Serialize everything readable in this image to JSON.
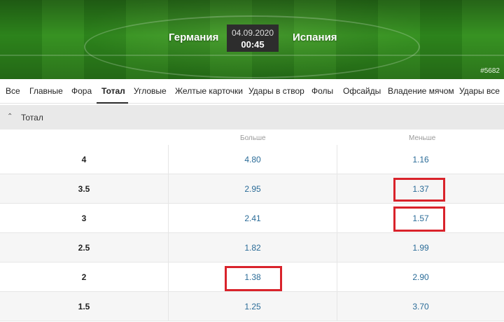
{
  "match": {
    "home_team": "Германия",
    "away_team": "Испания",
    "date": "04.09.2020",
    "time": "00:45",
    "id": "#5682"
  },
  "tabs": [
    {
      "label": "Все"
    },
    {
      "label": "Главные"
    },
    {
      "label": "Фора"
    },
    {
      "label": "Тотал",
      "active": true
    },
    {
      "label": "Угловые"
    },
    {
      "label": "Желтые карточки"
    },
    {
      "label": "Удары в створ"
    },
    {
      "label": "Фолы"
    },
    {
      "label": "Офсайды"
    },
    {
      "label": "Владение мячом"
    },
    {
      "label": "Удары все"
    }
  ],
  "section": {
    "title": "Тотал",
    "expanded": true,
    "chevron_icon": "chevron-up-icon"
  },
  "columns": {
    "over": "Больше",
    "under": "Меньше"
  },
  "rows": [
    {
      "line": "4",
      "over": "4.80",
      "under": "1.16"
    },
    {
      "line": "3.5",
      "over": "2.95",
      "under": "1.37"
    },
    {
      "line": "3",
      "over": "2.41",
      "under": "1.57"
    },
    {
      "line": "2.5",
      "over": "1.82",
      "under": "1.99"
    },
    {
      "line": "2",
      "over": "1.38",
      "under": "2.90"
    },
    {
      "line": "1.5",
      "over": "1.25",
      "under": "3.70"
    }
  ],
  "highlighted_odds": [
    {
      "line": "3.5",
      "side": "under"
    },
    {
      "line": "3",
      "side": "under"
    },
    {
      "line": "2",
      "side": "over"
    }
  ],
  "colors": {
    "odds_text": "#2b6c98",
    "highlight_border": "#d9232b",
    "pitch_green": "#3a9a24",
    "score_box": "#2d2d2d"
  }
}
